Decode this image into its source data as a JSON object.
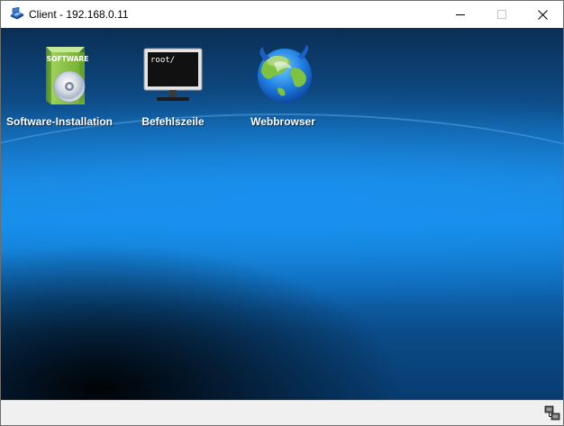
{
  "window": {
    "title": "Client - 192.168.0.11",
    "app_icon": "client-computer-icon",
    "controls": [
      "minimize-icon",
      "maximize-icon",
      "close-icon"
    ]
  },
  "desktop": {
    "icons": [
      {
        "label": "Software-Installation",
        "icon": "software-box-cd-icon",
        "box_text": "SOFTWARE"
      },
      {
        "label": "Befehlszeile",
        "icon": "terminal-monitor-icon",
        "screen_text": "root/"
      },
      {
        "label": "Webbrowser",
        "icon": "globe-browser-icon"
      }
    ]
  },
  "statusbar": {
    "icon": "network-connection-icon"
  },
  "colors": {
    "desktop_blue": "#1690ea",
    "desktop_dark": "#0a2e54",
    "statusbar_bg": "#f0f0f0",
    "close_hover": "#e81123"
  }
}
